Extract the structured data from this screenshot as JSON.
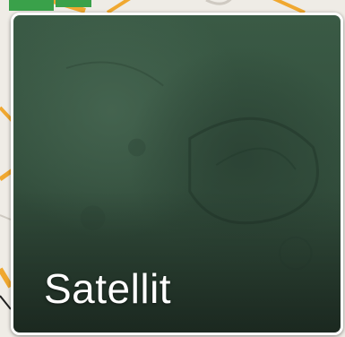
{
  "layer_tile": {
    "label": "Satellit"
  },
  "colors": {
    "map_background": "#efece6",
    "road_orange": "#f0a830",
    "park_green": "#3aa14a",
    "satellite_green": "#35523f",
    "label_text": "#ffffff"
  }
}
